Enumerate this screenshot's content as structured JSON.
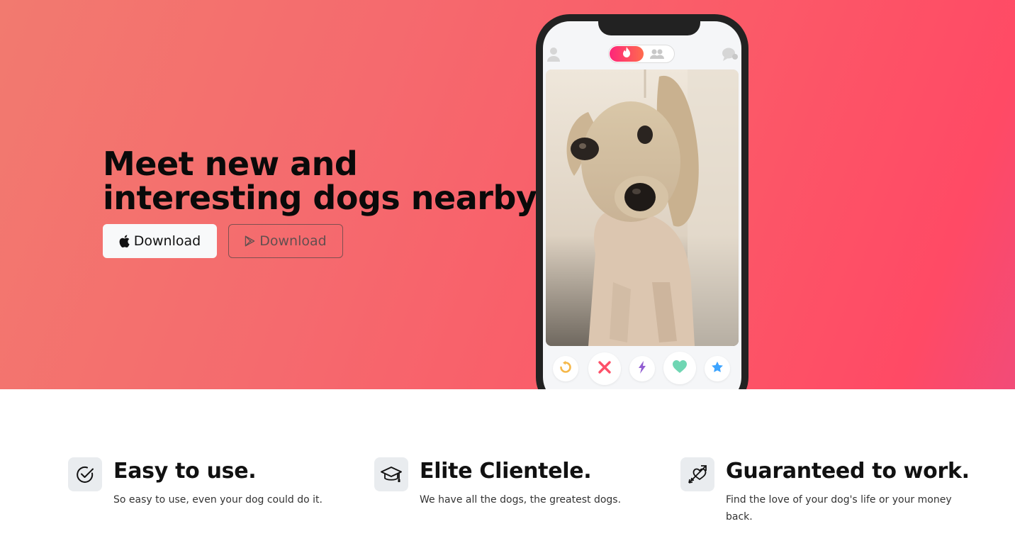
{
  "hero": {
    "headline_line1": "Meet new and",
    "headline_line2": "interesting dogs nearby.",
    "buttons": {
      "apple_label": "Download",
      "play_label": "Download"
    },
    "gradient_colors": [
      "#f27a6f",
      "#ff4a65"
    ]
  },
  "phone": {
    "icons": [
      "profile-icon",
      "flame-icon",
      "friends-icon",
      "chat-icon"
    ],
    "actions": [
      "rewind-icon",
      "nope-icon",
      "boost-icon",
      "like-icon",
      "super-like-icon"
    ],
    "action_colors": {
      "rewind": "#f5b748",
      "nope": "#fd5068",
      "boost": "#915dd1",
      "like": "#2db391",
      "super_like": "#3ca4ff"
    }
  },
  "features": [
    {
      "icon": "check-circle-icon",
      "title": "Easy to use.",
      "description": "So easy to use, even your dog could do it."
    },
    {
      "icon": "graduation-cap-icon",
      "title": "Elite Clientele.",
      "description": "We have all the dogs, the greatest dogs."
    },
    {
      "icon": "heart-arrow-icon",
      "title": "Guaranteed to work.",
      "description": "Find the love of your dog's life or your money back."
    }
  ]
}
